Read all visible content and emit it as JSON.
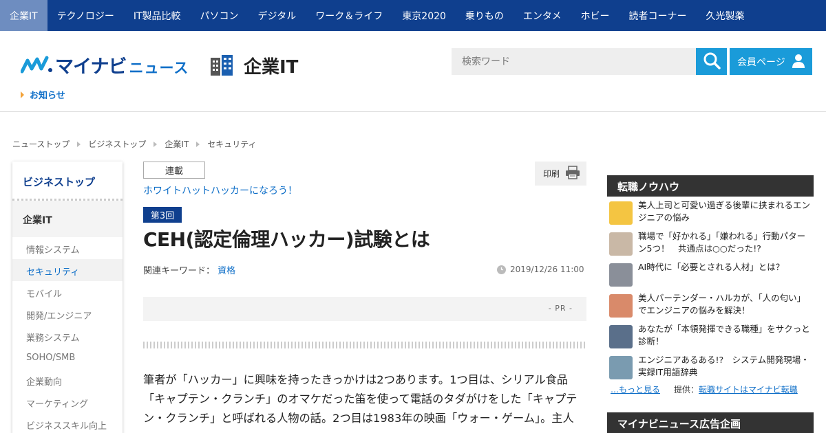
{
  "topnav": {
    "items": [
      "企業IT",
      "テクノロジー",
      "IT製品比較",
      "パソコン",
      "デジタル",
      "ワーク＆ライフ",
      "東京2020",
      "乗りもの",
      "エンタメ",
      "ホビー",
      "読者コーナー",
      "久光製薬"
    ],
    "active_index": 0
  },
  "header": {
    "logo_main": "マイナビ",
    "logo_sub": "ニュース",
    "section_name": "企業IT",
    "notice": "お知らせ",
    "search_placeholder": "検索ワード",
    "member_label": "会員ページ"
  },
  "breadcrumb": [
    "ニューストップ",
    "ビジネストップ",
    "企業IT",
    "セキュリティ"
  ],
  "sidebar": {
    "top_label": "ビジネストップ",
    "section_label": "企業IT",
    "items": [
      "情報システム",
      "セキュリティ",
      "モバイル",
      "開発/エンジニア",
      "業務システム",
      "SOHO/SMB",
      "企業動向",
      "マーケティング",
      "ビジネススキル向上"
    ],
    "active_index": 1
  },
  "article": {
    "series_tag": "連載",
    "series_name": "ホワイトハットハッカーになろう！",
    "print_label": "印刷",
    "episode": "第3回",
    "title": "CEH(認定倫理ハッカー)試験とは",
    "keywords_label": "関連キーワード：",
    "keyword": "資格",
    "date": "2019/12/26 11:00",
    "pr_label": "- PR -",
    "body_lines": [
      "筆者が「ハッカー」に興味を持ったきっかけは2つあります。1つ目は、シリアル食品",
      "「キャプテン・クランチ」のオマケだった笛を使って電話のタダがけをした「キャプテ",
      "ン・クランチ」と呼ばれる人物の話。2つ目は1983年の映画「ウォー・ゲーム」。主人"
    ]
  },
  "rightcol": {
    "section1_title": "転職ノウハウ",
    "items": [
      {
        "text": "美人上司と可愛い過ぎる後輩に挟まれるエンジニアの悩み",
        "thumb_color": "#f4c542"
      },
      {
        "text": "職場で「好かれる」「嫌われる」行動パターン5つ！　共通点は○○だった!?",
        "thumb_color": "#c9b8a6"
      },
      {
        "text": "AI時代に「必要とされる人材」とは？",
        "thumb_color": "#8a8f99"
      },
      {
        "text": "美人バーテンダー・ハルカが、「人の匂い」でエンジニアの悩みを解決！",
        "thumb_color": "#d98a6a"
      },
      {
        "text": "あなたが「本領発揮できる職種」をサクっと診断！",
        "thumb_color": "#5a6f8a"
      },
      {
        "text": "エンジニアあるある!?　システム開発現場・実録IT用語辞典",
        "thumb_color": "#7a9bb0"
      }
    ],
    "more_label": "…もっと見る",
    "provider_label": "提供：",
    "provider_link": "転職サイトはマイナビ転職",
    "section2_title": "マイナビニュース広告企画"
  }
}
